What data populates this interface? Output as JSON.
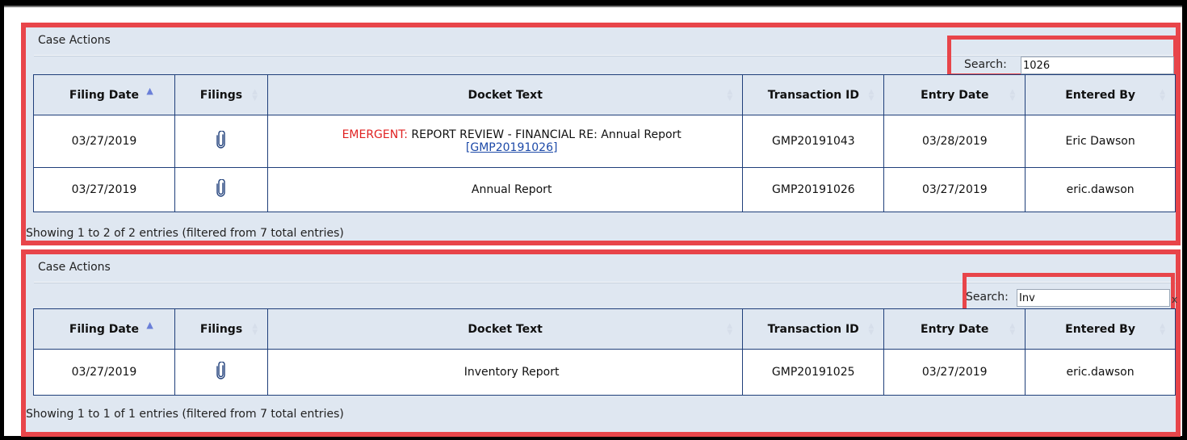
{
  "panels": [
    {
      "title": "Case Actions",
      "search": {
        "label": "Search:",
        "value": "1026"
      },
      "columns": [
        "Filing Date",
        "Filings",
        "Docket Text",
        "Transaction ID",
        "Entry Date",
        "Entered By"
      ],
      "rows": [
        {
          "filing_date": "03/27/2019",
          "docket_prefix": "EMERGENT:",
          "docket_text": " REPORT REVIEW - FINANCIAL RE: Annual Report",
          "docket_link": "[GMP20191026]",
          "transaction_id": "GMP20191043",
          "entry_date": "03/28/2019",
          "entered_by": "Eric Dawson"
        },
        {
          "filing_date": "03/27/2019",
          "docket_text": "Annual Report",
          "transaction_id": "GMP20191026",
          "entry_date": "03/27/2019",
          "entered_by": "eric.dawson"
        }
      ],
      "footer": "Showing 1 to 2 of 2 entries (filtered from 7 total entries)"
    },
    {
      "title": "Case Actions",
      "search": {
        "label": "Search:",
        "value": "Inv",
        "clear": "x"
      },
      "columns": [
        "Filing Date",
        "Filings",
        "Docket Text",
        "Transaction ID",
        "Entry Date",
        "Entered By"
      ],
      "rows": [
        {
          "filing_date": "03/27/2019",
          "docket_text": "Inventory Report",
          "transaction_id": "GMP20191025",
          "entry_date": "03/27/2019",
          "entered_by": "eric.dawson"
        }
      ],
      "footer": "Showing 1 to 1 of 1 entries (filtered from 7 total entries)"
    }
  ],
  "icons": {
    "attachment": "paperclip-icon",
    "sort_asc": "sort-ascending-icon",
    "sort": "sort-both-icon"
  },
  "colors": {
    "highlight": "#e8454a",
    "panel_bg": "#dfe7f1",
    "border": "#1f3f7a",
    "emergent": "#e02222",
    "link": "#1d4aa8"
  }
}
